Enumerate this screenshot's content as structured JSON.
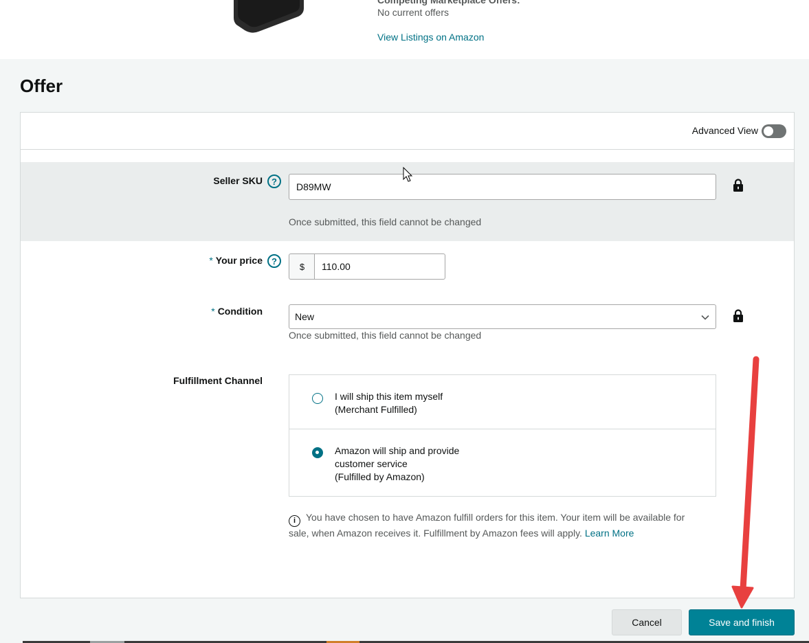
{
  "product": {
    "competing_label": "Competing Marketplace Offers:",
    "offers_value": "No current offers",
    "listings_link": "View Listings on Amazon"
  },
  "offer": {
    "title": "Offer",
    "advanced_view_label": "Advanced View",
    "advanced_view_on": false
  },
  "form": {
    "seller_sku": {
      "label": "Seller SKU",
      "help": "?",
      "value": "D89MW",
      "helper": "Once submitted, this field cannot be changed"
    },
    "your_price": {
      "required_mark": "*",
      "label": "Your price",
      "help": "?",
      "currency": "$",
      "value": "110.00"
    },
    "condition": {
      "required_mark": "*",
      "label": "Condition",
      "value": "New",
      "helper": "Once submitted, this field cannot be changed"
    },
    "fulfillment": {
      "label": "Fulfillment Channel",
      "options": [
        {
          "line1": "I will ship this item myself",
          "line2": "(Merchant Fulfilled)",
          "line3": "",
          "selected": false
        },
        {
          "line1": "Amazon will ship and provide",
          "line2": "customer service",
          "line3": "(Fulfilled by Amazon)",
          "selected": true
        }
      ],
      "info_icon": "i",
      "info_text": "You have chosen to have Amazon fulfill orders for this item. Your item will be available for sale, when Amazon receives it. Fulfillment by Amazon fees will apply.",
      "learn_more": "Learn More"
    }
  },
  "actions": {
    "cancel": "Cancel",
    "save": "Save and finish"
  },
  "colors": {
    "accent": "#007185",
    "primary_button": "#008296",
    "annotation_arrow": "#e8403f"
  },
  "icons": {
    "lock": "lock-icon",
    "help": "help-icon",
    "chevron": "chevron-down-icon",
    "info": "info-icon",
    "cursor": "mouse-cursor-icon",
    "arrow": "red-arrow-annotation"
  }
}
